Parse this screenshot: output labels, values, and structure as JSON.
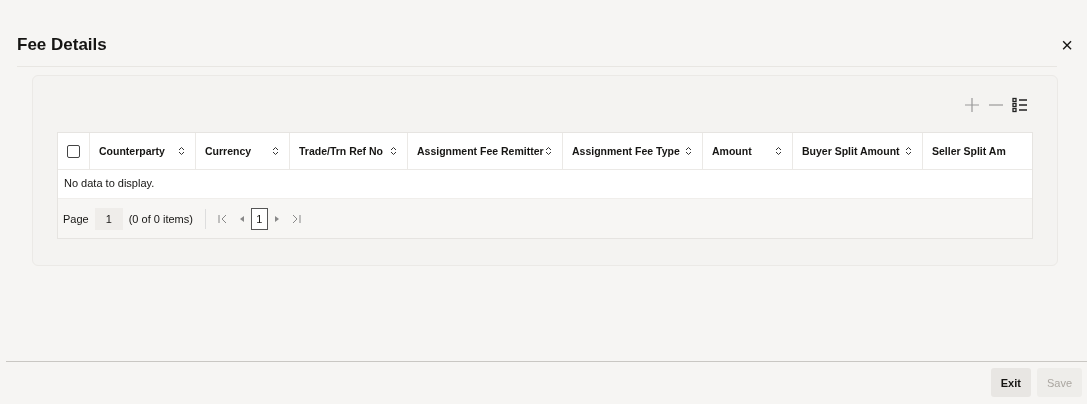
{
  "dialog": {
    "title": "Fee Details",
    "close": "×"
  },
  "table": {
    "select_all_checked": false,
    "columns": [
      {
        "label": "Counterparty",
        "sortable": true
      },
      {
        "label": "Currency",
        "sortable": true
      },
      {
        "label": "Trade/Trn Ref No",
        "sortable": true
      },
      {
        "label": "Assignment Fee Remitter",
        "sortable": true
      },
      {
        "label": "Assignment Fee Type",
        "sortable": true
      },
      {
        "label": "Amount",
        "sortable": true
      },
      {
        "label": "Buyer Split Amount",
        "sortable": true
      },
      {
        "label": "Seller Split Am",
        "sortable": false
      }
    ],
    "empty_message": "No data to display."
  },
  "pager": {
    "label": "Page",
    "page": "1",
    "summary": "(0 of 0 items)",
    "current": "1"
  },
  "buttons": [
    {
      "label": "Exit",
      "disabled": false
    },
    {
      "label": "Save",
      "disabled": true
    }
  ]
}
